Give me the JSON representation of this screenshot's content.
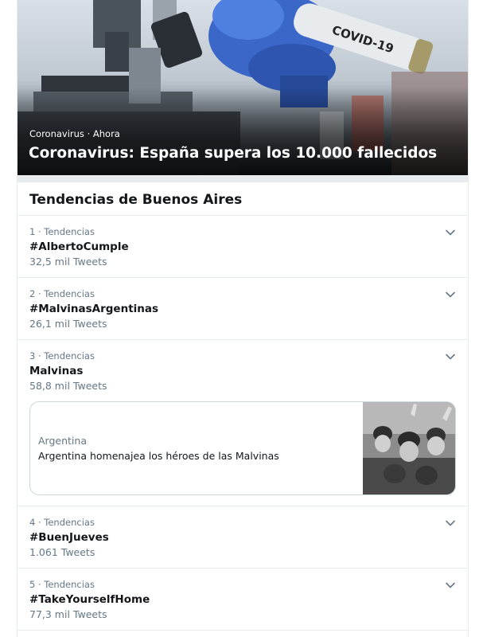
{
  "hero": {
    "image_label": "COVID-19",
    "meta": "Coronavirus · Ahora",
    "title": "Coronavirus: España supera los 10.000 fallecidos"
  },
  "section": {
    "title": "Tendencias de Buenos Aires"
  },
  "trends": [
    {
      "meta": "1 · Tendencias",
      "name": "#AlbertoCumple",
      "count": "32,5 mil Tweets"
    },
    {
      "meta": "2 · Tendencias",
      "name": "#MalvinasArgentinas",
      "count": "26,1 mil Tweets"
    },
    {
      "meta": "3 · Tendencias",
      "name": "Malvinas",
      "count": "58,8 mil Tweets",
      "story": {
        "source": "Argentina",
        "headline": "Argentina homenajea los héroes de las Malvinas"
      }
    },
    {
      "meta": "4 · Tendencias",
      "name": "#BuenJueves",
      "count": "1.061 Tweets"
    },
    {
      "meta": "5 · Tendencias",
      "name": "#TakeYourselfHome",
      "count": "77,3 mil Tweets"
    }
  ],
  "icons": {
    "chevron": "chevron-down-icon"
  },
  "colors": {
    "secondary_text": "#657786",
    "primary_text": "#14171a",
    "divider": "#e6ecf0"
  }
}
